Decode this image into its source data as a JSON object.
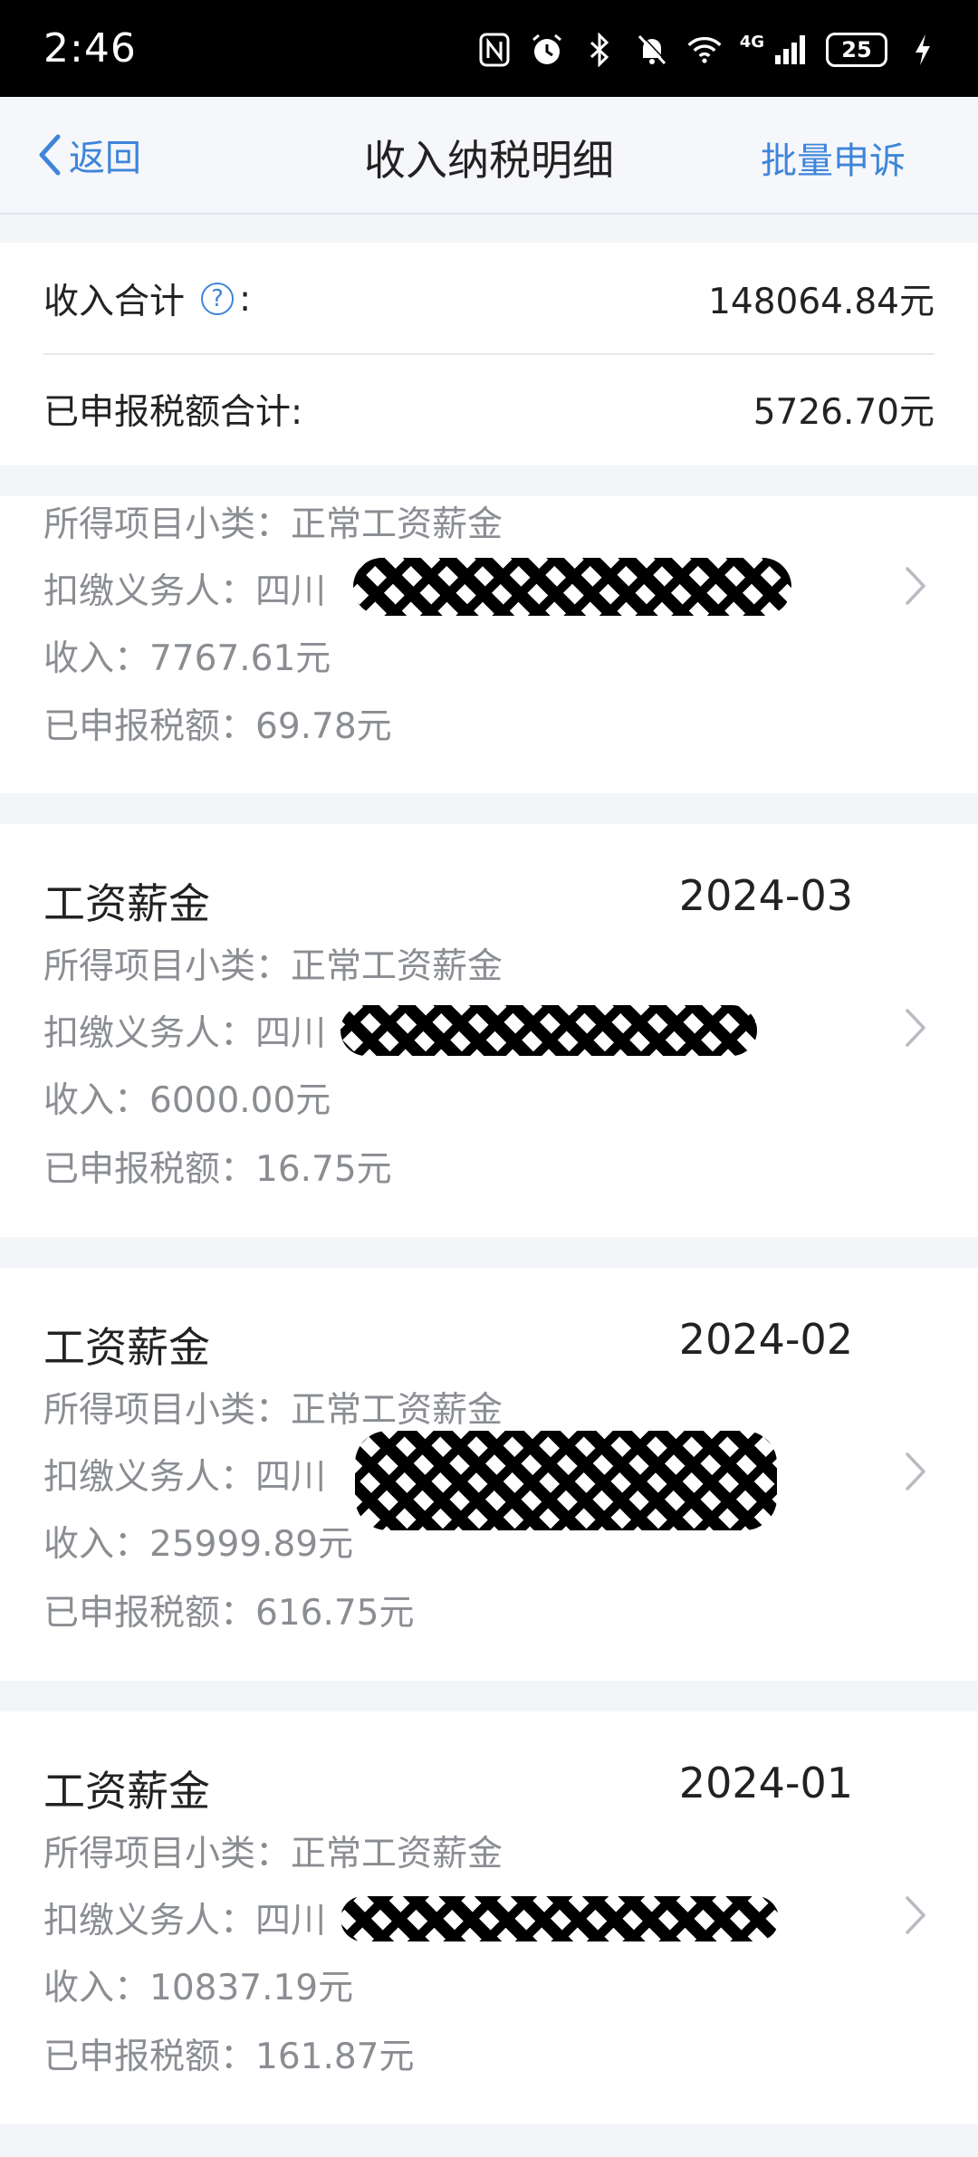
{
  "status_bar": {
    "time": "2:46",
    "network": "4G",
    "battery": "25",
    "icons": [
      "nfc-icon",
      "alarm-icon",
      "bluetooth-icon",
      "mute-icon",
      "wifi-icon",
      "signal-icon",
      "charging-icon"
    ]
  },
  "nav": {
    "back_label": "返回",
    "title": "收入纳税明细",
    "action_label": "批量申诉"
  },
  "summary": {
    "income_label": "收入合计",
    "income_colon": ":",
    "income_value": "148064.84元",
    "tax_label": "已申报税额合计:",
    "tax_value": "5726.70元",
    "help_glyph": "?"
  },
  "records": [
    {
      "title": "",
      "date": "",
      "subcategory": "所得项目小类：正常工资薪金",
      "withholder": "扣缴义务人：四川",
      "income": "收入：7767.61元",
      "tax": "已申报税额：69.78元"
    },
    {
      "title": "工资薪金",
      "date": "2024-03",
      "subcategory": "所得项目小类：正常工资薪金",
      "withholder": "扣缴义务人：四川",
      "income": "收入：6000.00元",
      "tax": "已申报税额：16.75元"
    },
    {
      "title": "工资薪金",
      "date": "2024-02",
      "subcategory": "所得项目小类：正常工资薪金",
      "withholder": "扣缴义务人：四川",
      "income": "收入：25999.89元",
      "tax": "已申报税额：616.75元"
    },
    {
      "title": "工资薪金",
      "date": "2024-01",
      "subcategory": "所得项目小类：正常工资薪金",
      "withholder": "扣缴义务人：四川",
      "income": "收入：10837.19元",
      "tax": "已申报税额：161.87元"
    }
  ],
  "colors": {
    "accent": "#3e85d9",
    "secondary_text": "#8a8d92",
    "background": "#f3f5f9"
  }
}
